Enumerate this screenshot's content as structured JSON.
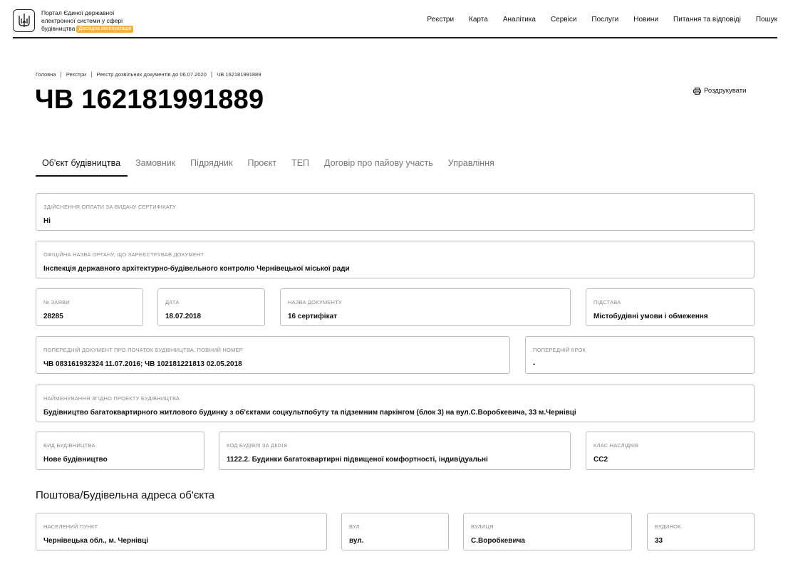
{
  "header": {
    "brand_lines": [
      "Портал Єдиної державної",
      "електронної системи у сфері",
      "будівництва"
    ],
    "badge": "Дослідна експлуатація",
    "nav": [
      "Реєстри",
      "Карта",
      "Аналітика",
      "Сервіси",
      "Послуги",
      "Новини",
      "Питання та відповіді",
      "Пошук"
    ]
  },
  "breadcrumb": [
    "Головна",
    "Реєстри",
    "Реєстр дозвільних документів до 06.07.2020",
    "ЧВ 162181991889"
  ],
  "page_title": "ЧВ 162181991889",
  "print_label": "Роздрукувати",
  "tabs": [
    "Об'єкт будівництва",
    "Замовник",
    "Підрядник",
    "Проєкт",
    "ТЕП",
    "Договір про пайову участь",
    "Управління"
  ],
  "fields": {
    "payment": {
      "label": "Здійснення оплати за видачу сертифікату",
      "value": "Ні"
    },
    "authority": {
      "label": "Офіційна назва органу, що зареєстрував документ",
      "value": "Інспекція державного архітектурно-будівельного контролю Чернівецької міської ради"
    },
    "app_no": {
      "label": "№ заяви",
      "value": "28285"
    },
    "date": {
      "label": "Дата",
      "value": "18.07.2018"
    },
    "doc_name": {
      "label": "Назва документу",
      "value": "16 сертифікат"
    },
    "basis": {
      "label": "Підстава",
      "value": "Містобудівні умови і обмеження"
    },
    "prev_doc": {
      "label": "Попередній документ про початок будівництва, повний номер",
      "value": "ЧВ 083161932324 11.07.2016; ЧВ 102181221813 02.05.2018"
    },
    "prev_step": {
      "label": "Попередній крок",
      "value": "-"
    },
    "project_name": {
      "label": "Найменування згідно проекту будівництва",
      "value": "Будівництво багатоквартирного житлового будинку з об'єктами соцкультпобуту та підземним паркінгом (блок 3) на вул.С.Воробкевича, 33 м.Чернівці"
    },
    "construction_type": {
      "label": "Вид будівництва",
      "value": "Нове будівництво"
    },
    "building_code": {
      "label": "Код будівлі за ДК018",
      "value": "1122.2. Будинки багатоквартирні підвищеної комфортності, індивідуальні"
    },
    "consequence_class": {
      "label": "Клас наслідків",
      "value": "СС2"
    }
  },
  "address_section_title": "Поштова/Будівельна адреса об'єкта",
  "address": {
    "settlement": {
      "label": "Населений пункт",
      "value": "Чернівецька обл., м. Чернівці"
    },
    "street_type": {
      "label": "Вул.",
      "value": "вул."
    },
    "street": {
      "label": "Вулиця",
      "value": "С.Воробкевича"
    },
    "building": {
      "label": "Будинок",
      "value": "33"
    }
  }
}
